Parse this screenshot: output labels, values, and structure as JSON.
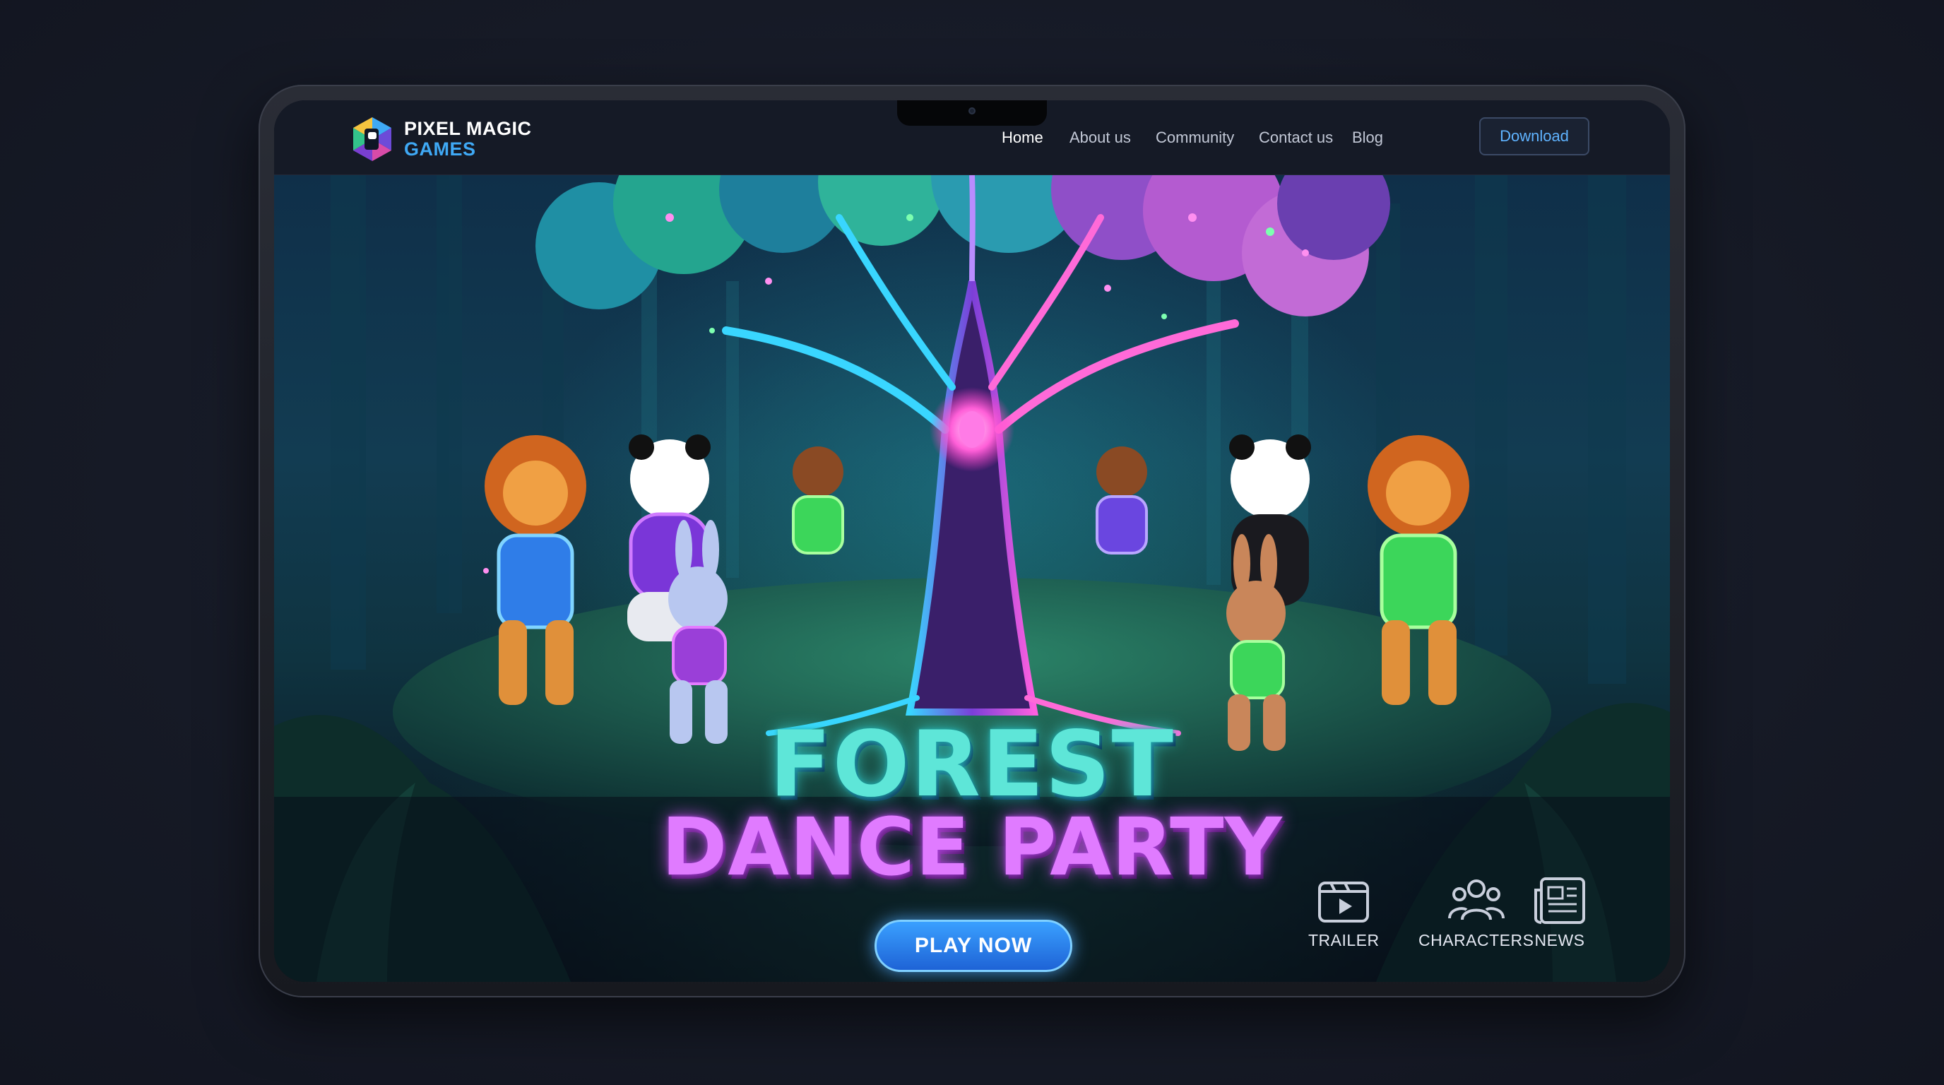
{
  "brand": {
    "line1": "PIXEL MAGIC",
    "line2": "GAMES"
  },
  "nav": {
    "items": [
      {
        "label": "Home",
        "active": true
      },
      {
        "label": "About us",
        "active": false
      },
      {
        "label": "Community",
        "active": false
      },
      {
        "label": "Contact us",
        "active": false
      },
      {
        "label": "Blog",
        "active": false
      }
    ],
    "download_label": "Download"
  },
  "hero": {
    "title_line1": "FOREST",
    "title_line2": "DANCE PARTY",
    "cta_label": "PLAY NOW",
    "quick_links": [
      {
        "label": "TRAILER",
        "icon": "video-play-icon"
      },
      {
        "label": "CHARACTERS",
        "icon": "people-group-icon"
      },
      {
        "label": "NEWS",
        "icon": "newspaper-icon"
      }
    ]
  },
  "colors": {
    "accent": "#3fa9f5",
    "title_teal": "#5ee6d8",
    "title_purple": "#e07bff",
    "cta": "#2a7ff0"
  }
}
